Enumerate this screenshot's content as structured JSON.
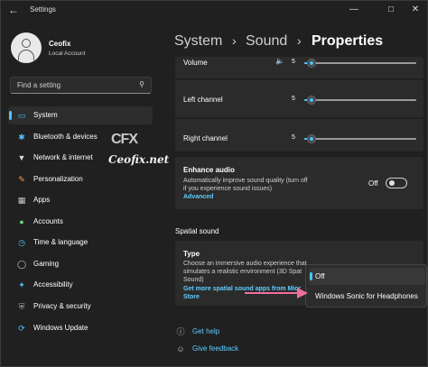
{
  "window": {
    "title": "Settings",
    "controls": [
      "minimize",
      "maximize",
      "close"
    ]
  },
  "user": {
    "name": "Ceofix",
    "account_type": "Local Account"
  },
  "search": {
    "placeholder": "Find a setting"
  },
  "nav": [
    {
      "label": "System",
      "icon": "monitor-icon",
      "active": true
    },
    {
      "label": "Bluetooth & devices",
      "icon": "bluetooth-icon"
    },
    {
      "label": "Network & internet",
      "icon": "wifi-icon"
    },
    {
      "label": "Personalization",
      "icon": "brush-icon"
    },
    {
      "label": "Apps",
      "icon": "apps-icon"
    },
    {
      "label": "Accounts",
      "icon": "person-icon"
    },
    {
      "label": "Time & language",
      "icon": "globe-clock-icon"
    },
    {
      "label": "Gaming",
      "icon": "gamepad-icon"
    },
    {
      "label": "Accessibility",
      "icon": "accessibility-icon"
    },
    {
      "label": "Privacy & security",
      "icon": "shield-icon"
    },
    {
      "label": "Windows Update",
      "icon": "update-icon"
    }
  ],
  "watermark": {
    "logo": "CFX",
    "text": "Ceofix.net"
  },
  "breadcrumb": {
    "items": [
      "System",
      "Sound",
      "Properties"
    ],
    "separator": "›"
  },
  "output_settings": {
    "volume": {
      "label": "Volume",
      "value": "5",
      "level": 0.05
    },
    "left_channel": {
      "label": "Left channel",
      "value": "5",
      "level": 0.05
    },
    "right_channel": {
      "label": "Right channel",
      "value": "5",
      "level": 0.05
    }
  },
  "enhance_audio": {
    "title": "Enhance audio",
    "description": "Automatically improve sound quality (turn off if you experience sound issues)",
    "link": "Advanced",
    "toggle_label": "Off",
    "state": false
  },
  "spatial_sound": {
    "section_title": "Spatial sound",
    "type_title": "Type",
    "type_description": "Choose an immersive audio experience that simulates a realistic environment (3D Spat Sound)",
    "link_line1": "Get more spatial sound apps from Micr",
    "link_line2": "Store",
    "options": [
      "Off",
      "Windows Sonic for Headphones"
    ],
    "selected_index": 0
  },
  "help": {
    "get_help": "Get help",
    "give_feedback": "Give feedback"
  },
  "colors": {
    "accent": "#4cc2ff",
    "link": "#60cdff",
    "arrow": "#f06ea0"
  }
}
